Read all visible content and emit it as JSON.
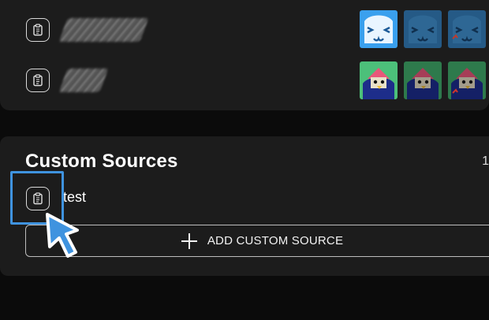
{
  "sources_list": {
    "rows": [
      {
        "name_obscured": true,
        "thumbnails": [
          "blue-face",
          "blue-face-dim",
          "blue-face-red-mark"
        ]
      },
      {
        "name_obscured": true,
        "thumbnails": [
          "green-bird",
          "green-bird-dim",
          "green-bird-red-mark"
        ]
      }
    ]
  },
  "custom_sources": {
    "title": "Custom Sources",
    "count_partial": "1",
    "items": [
      {
        "label": "test"
      }
    ],
    "add_button_label": "ADD CUSTOM SOURCE"
  },
  "colors": {
    "page_bg": "#0b0b0b",
    "card_bg": "#1c1c1c",
    "highlight": "#3f93df",
    "thumb_blue": "#3aa0ee",
    "thumb_green": "#4cc07a"
  },
  "icons": {
    "copy": "clipboard-icon",
    "add": "plus-icon",
    "pointer": "cursor-arrow-icon"
  }
}
